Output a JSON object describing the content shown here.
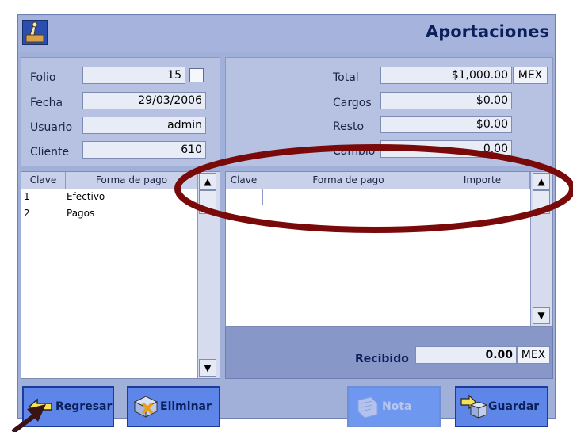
{
  "window": {
    "title": "Aportaciones"
  },
  "form": {
    "folio_label": "Folio",
    "folio_value": "15",
    "fecha_label": "Fecha",
    "fecha_value": "29/03/2006",
    "usuario_label": "Usuario",
    "usuario_value": "admin",
    "cliente_label": "Cliente",
    "cliente_value": "610"
  },
  "totals": {
    "total_label": "Total",
    "total_value": "$1,000.00",
    "total_currency": "MEX",
    "cargos_label": "Cargos",
    "cargos_value": "$0.00",
    "resto_label": "Resto",
    "resto_value": "$0.00",
    "cambio_label": "Cambio",
    "cambio_value": "0.00"
  },
  "payment_methods": {
    "headers": [
      "Clave",
      "Forma de pago"
    ],
    "rows": [
      {
        "clave": "1",
        "forma": "Efectivo"
      },
      {
        "clave": "2",
        "forma": "Pagos"
      }
    ]
  },
  "payments": {
    "headers": [
      "Clave",
      "Forma de pago",
      "Importe"
    ],
    "rows": []
  },
  "received": {
    "label": "Recibido",
    "value": "0.00",
    "currency": "MEX"
  },
  "buttons": {
    "regresar_hotkey": "R",
    "regresar_rest": "egresar",
    "eliminar_hotkey": "E",
    "eliminar_rest": "liminar",
    "nota_hotkey": "N",
    "nota_rest": "ota",
    "guardar_hotkey": "G",
    "guardar_rest": "uardar"
  },
  "annotation": {
    "color": "#7a0a0a"
  }
}
